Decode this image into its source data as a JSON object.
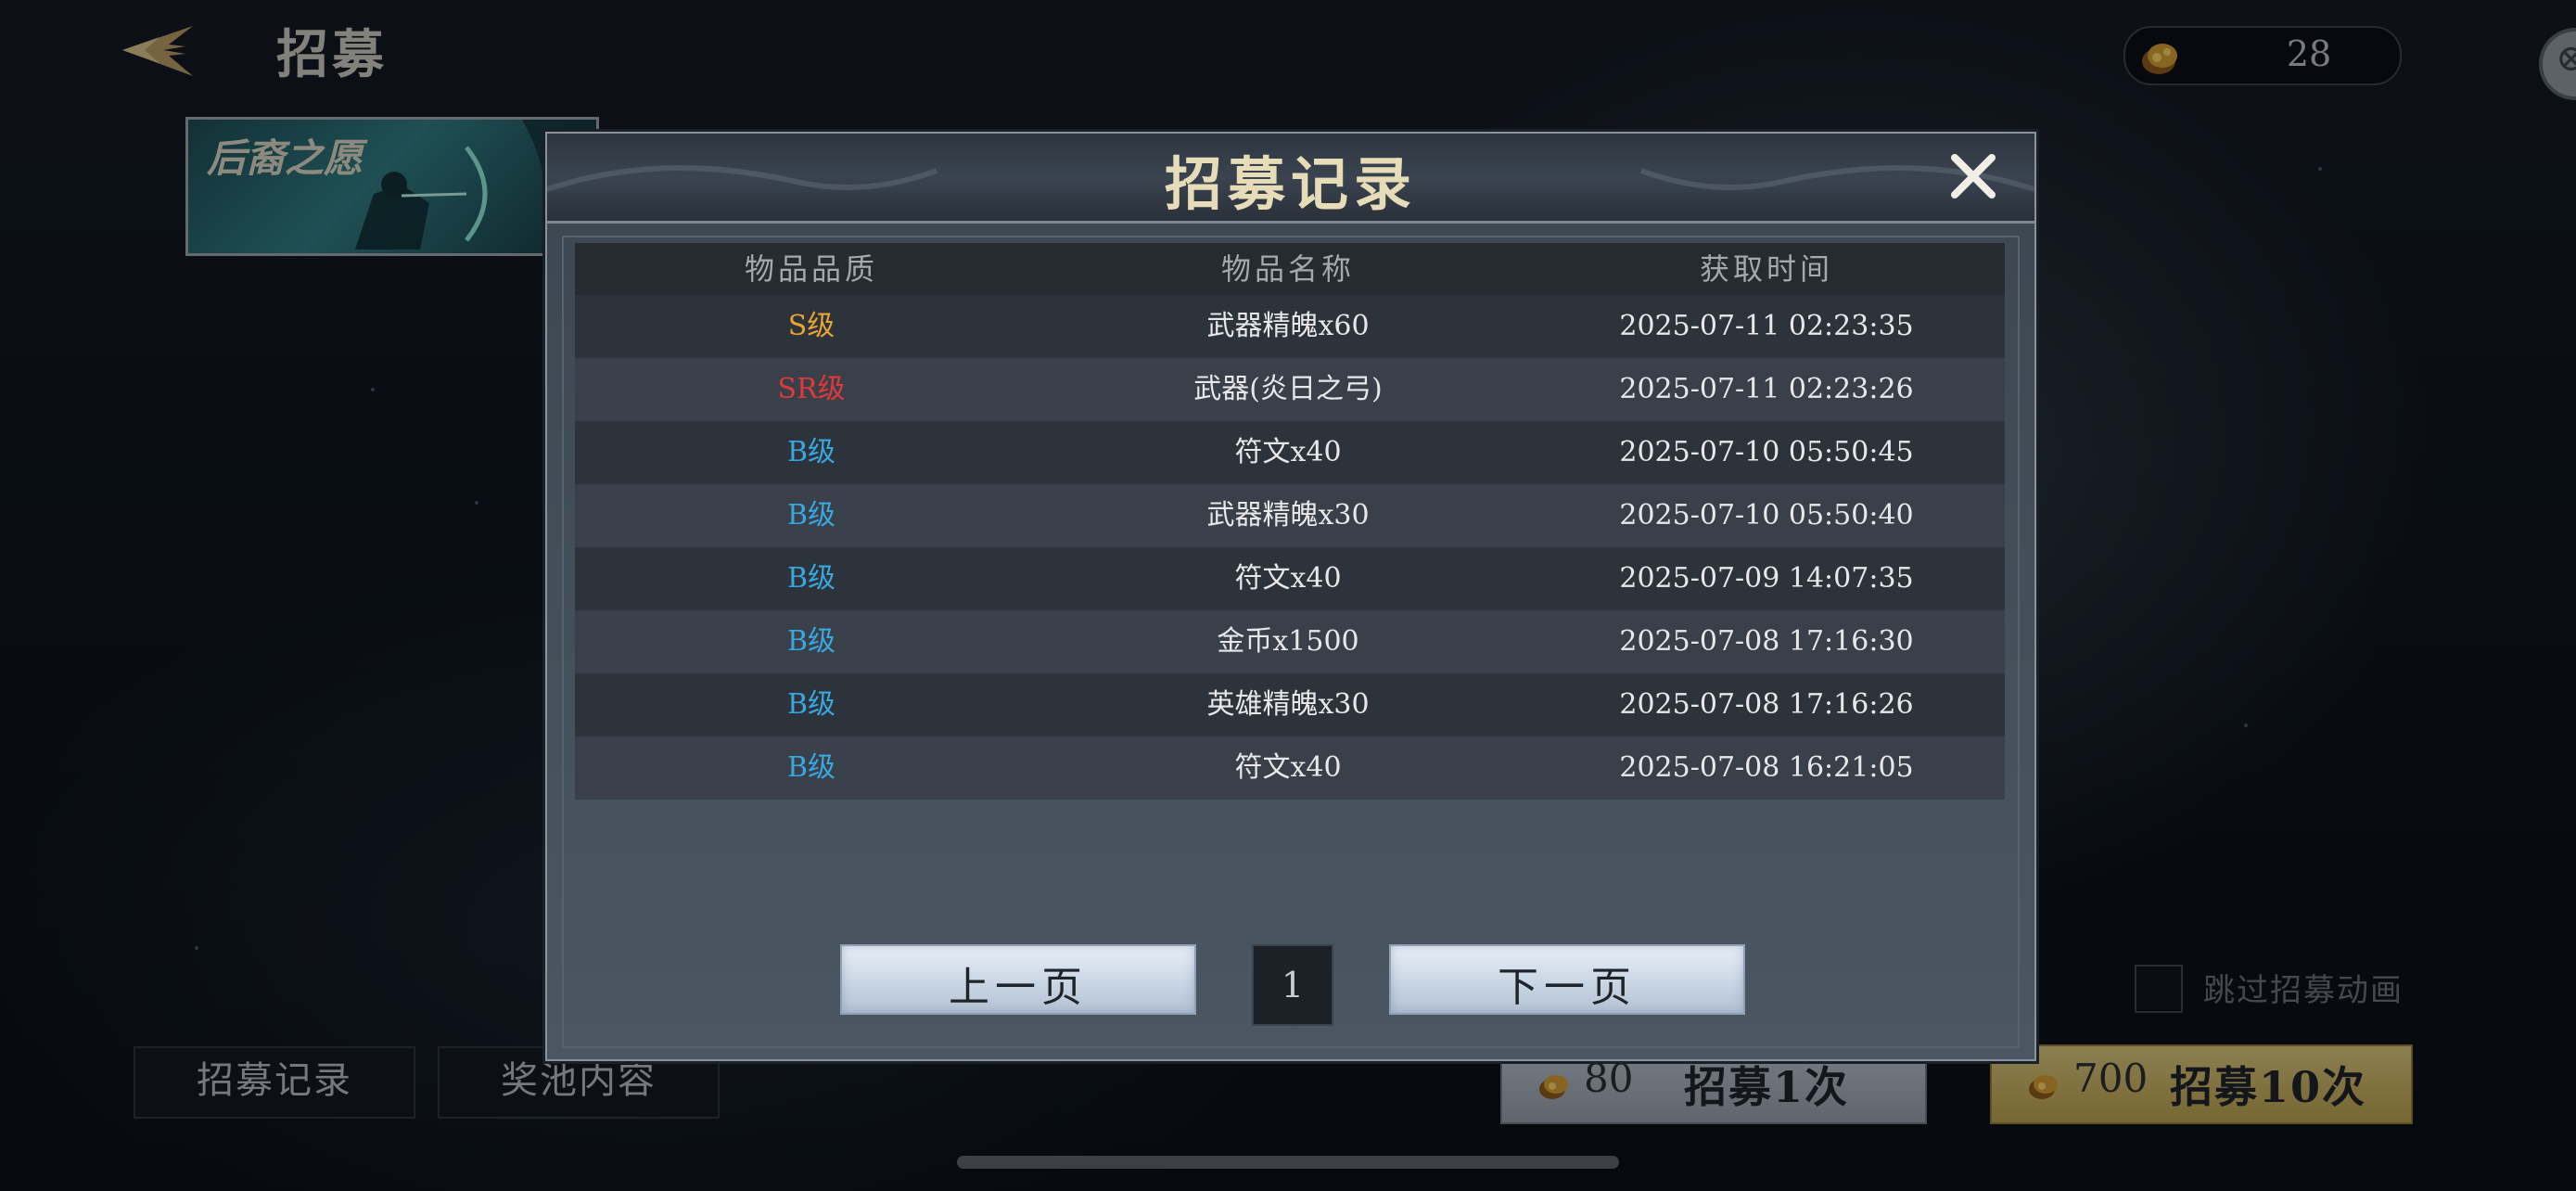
{
  "header": {
    "title": "招募",
    "currency_amount": "28",
    "currency_icon": "gold-coin-icon"
  },
  "banner": {
    "title": "后裔之愿"
  },
  "modal": {
    "title": "招募记录",
    "columns": [
      "物品品质",
      "物品名称",
      "获取时间"
    ],
    "rows": [
      {
        "quality": "S级",
        "quality_color": "#e9a531",
        "name": "武器精魄x60",
        "time": "2025-07-11 02:23:35"
      },
      {
        "quality": "SR级",
        "quality_color": "#e0393a",
        "name": "武器(炎日之弓)",
        "time": "2025-07-11 02:23:26"
      },
      {
        "quality": "B级",
        "quality_color": "#3aa7e0",
        "name": "符文x40",
        "time": "2025-07-10 05:50:45"
      },
      {
        "quality": "B级",
        "quality_color": "#3aa7e0",
        "name": "武器精魄x30",
        "time": "2025-07-10 05:50:40"
      },
      {
        "quality": "B级",
        "quality_color": "#3aa7e0",
        "name": "符文x40",
        "time": "2025-07-09 14:07:35"
      },
      {
        "quality": "B级",
        "quality_color": "#3aa7e0",
        "name": "金币x1500",
        "time": "2025-07-08 17:16:30"
      },
      {
        "quality": "B级",
        "quality_color": "#3aa7e0",
        "name": "英雄精魄x30",
        "time": "2025-07-08 17:16:26"
      },
      {
        "quality": "B级",
        "quality_color": "#3aa7e0",
        "name": "符文x40",
        "time": "2025-07-08 16:21:05"
      }
    ],
    "prev_label": "上一页",
    "next_label": "下一页",
    "page_number": "1"
  },
  "bottom": {
    "tab_records": "招募记录",
    "tab_pool": "奖池内容",
    "skip_animation_label": "跳过招募动画",
    "recruit_once": {
      "cost": "80",
      "label": "招募1次"
    },
    "recruit_ten": {
      "cost": "700",
      "label": "招募10次"
    }
  }
}
